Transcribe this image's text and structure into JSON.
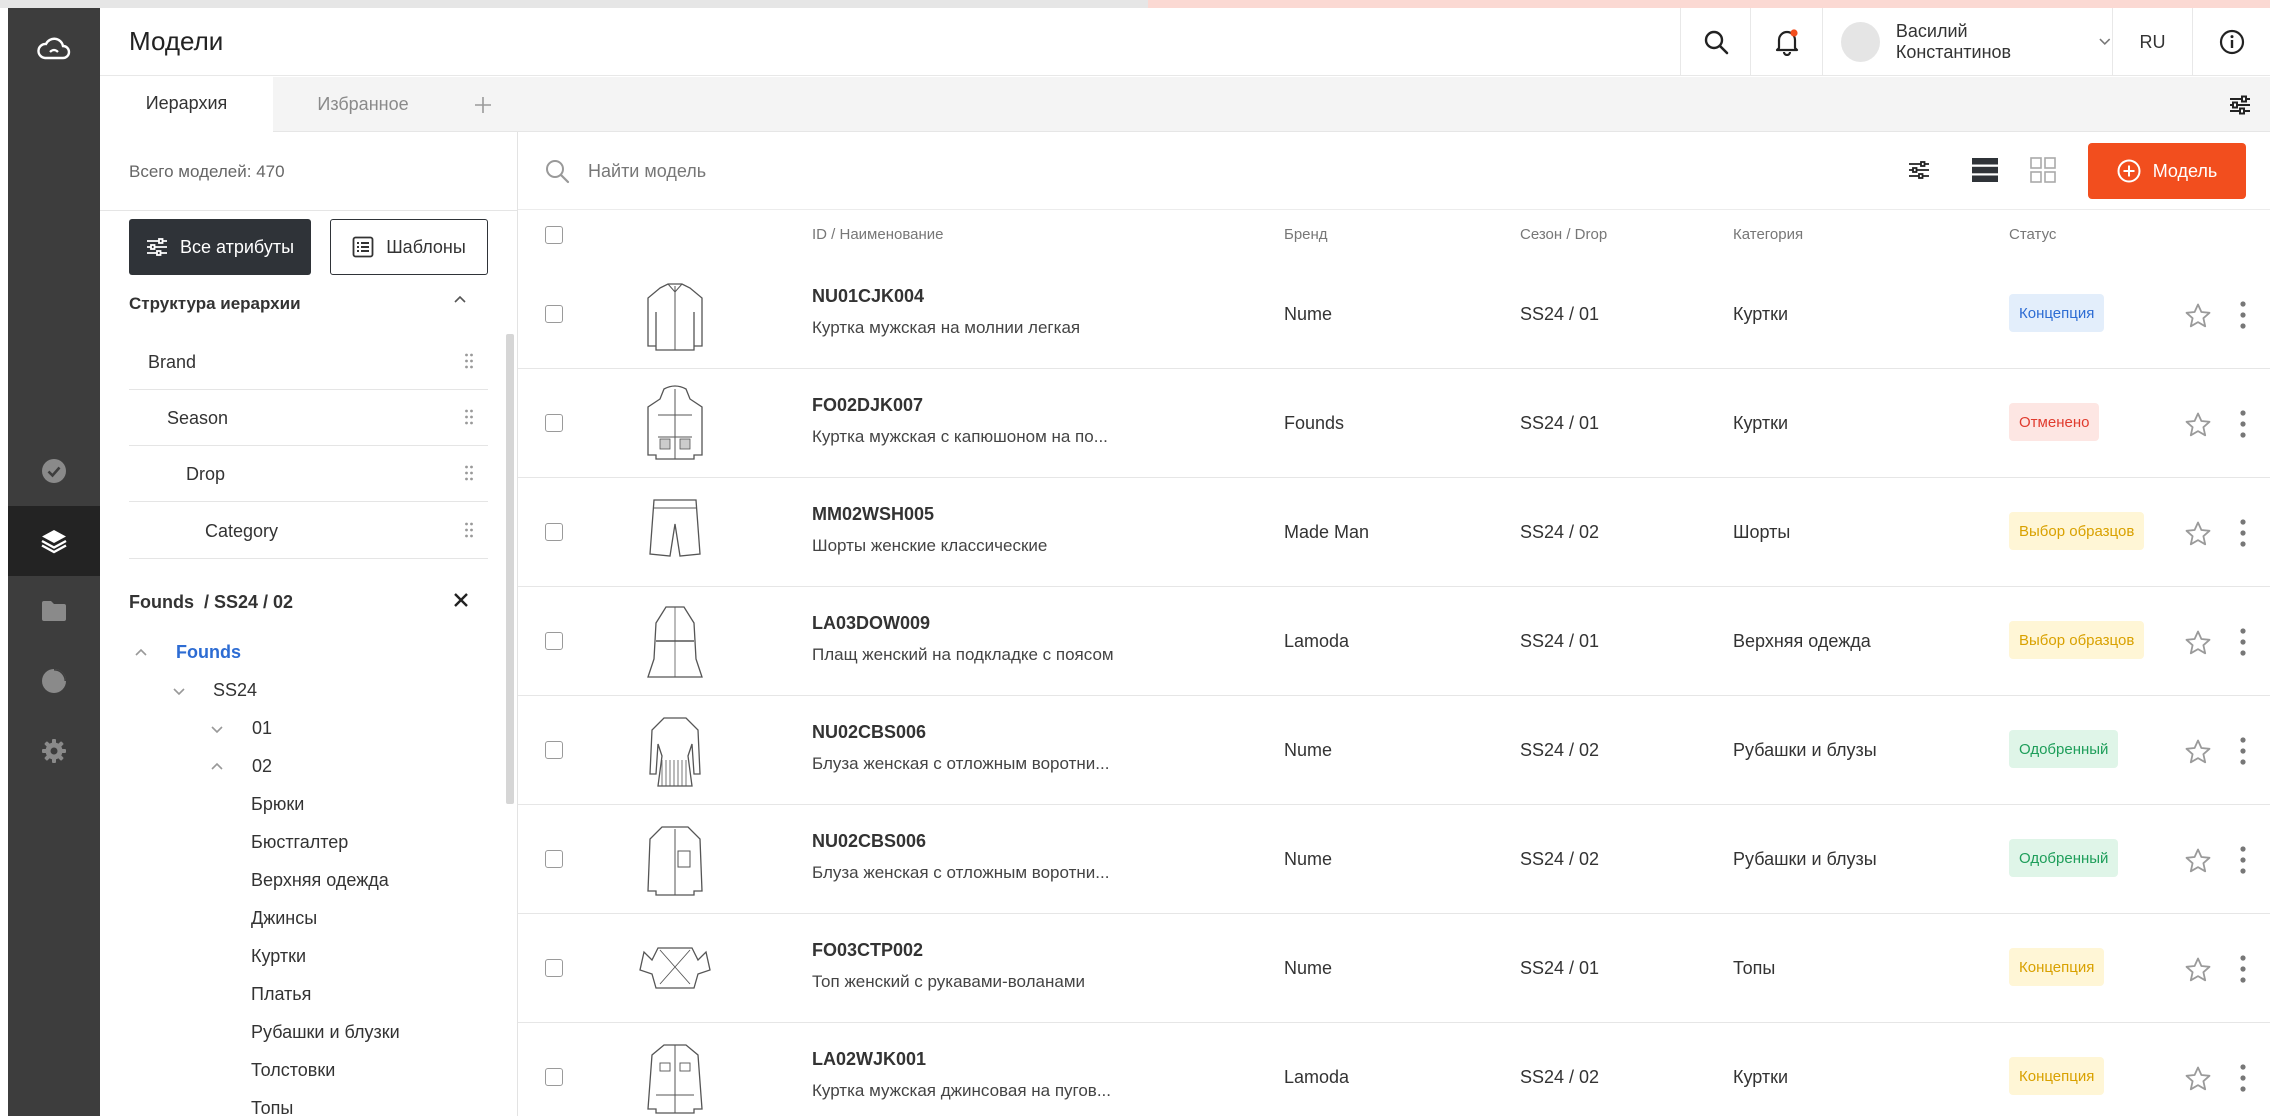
{
  "header": {
    "title": "Модели",
    "user_name": "Василий Константинов",
    "lang": "RU"
  },
  "tabs": [
    {
      "label": "Иерархия"
    },
    {
      "label": "Избранное"
    }
  ],
  "left_panel": {
    "count_label": "Всего моделей: 470",
    "all_attrs_label": "Все атрибуты",
    "templates_label": "Шаблоны",
    "structure_title": "Структура иерархии",
    "levels": [
      "Brand",
      "Season",
      "Drop",
      "Category"
    ],
    "path": "Founds  / SS24 / 02",
    "tree": {
      "brand": "Founds",
      "season": "SS24",
      "drops": [
        "01",
        "02"
      ],
      "categories": [
        "Брюки",
        "Бюстгалтер",
        "Верхняя одежда",
        "Джинсы",
        "Куртки",
        "Платья",
        "Рубашки и блузки",
        "Толстовки",
        "Топы"
      ]
    }
  },
  "search": {
    "placeholder": "Найти модель"
  },
  "add_model_label": "Модель",
  "table": {
    "columns": [
      "ID / Наименование",
      "Бренд",
      "Сезон / Drop",
      "Категория",
      "Статус"
    ],
    "rows": [
      {
        "id": "NU01CJK004",
        "name": "Куртка мужская на молнии легкая",
        "brand": "Nume",
        "season": "SS24 / 01",
        "category": "Куртки",
        "status": "Концепция",
        "status_color": "#2d6cd3",
        "status_bg": "#e3eefb"
      },
      {
        "id": "FO02DJK007",
        "name": "Куртка мужская с капюшоном на по...",
        "brand": "Founds",
        "season": "SS24 / 01",
        "category": "Куртки",
        "status": "Отменено",
        "status_color": "#e03b2e",
        "status_bg": "#fde6e3"
      },
      {
        "id": "MM02WSH005",
        "name": "Шорты женские классические",
        "brand": "Made Man",
        "season": "SS24 / 02",
        "category": "Шорты",
        "status": "Выбор образцов",
        "status_color": "#d9a100",
        "status_bg": "#fff6d6"
      },
      {
        "id": "LA03DOW009",
        "name": "Плащ женский на подкладке с поясом",
        "brand": "Lamoda",
        "season": "SS24 / 01",
        "category": "Верхняя одежда",
        "status": "Выбор образцов",
        "status_color": "#d9a100",
        "status_bg": "#fff6d6"
      },
      {
        "id": "NU02CBS006",
        "name": "Блуза женская с отложным воротни...",
        "brand": "Nume",
        "season": "SS24 / 02",
        "category": "Рубашки и блузы",
        "status": "Одобренный",
        "status_color": "#1e9e5a",
        "status_bg": "#dff5e8"
      },
      {
        "id": "NU02CBS006",
        "name": "Блуза женская с отложным воротни...",
        "brand": "Nume",
        "season": "SS24 / 02",
        "category": "Рубашки и блузы",
        "status": "Одобренный",
        "status_color": "#1e9e5a",
        "status_bg": "#dff5e8"
      },
      {
        "id": "FO03CTP002",
        "name": "Топ женский с рукавами-воланами",
        "brand": "Nume",
        "season": "SS24 / 01",
        "category": "Топы",
        "status": "Концепция",
        "status_color": "#d9a100",
        "status_bg": "#fff6d6"
      },
      {
        "id": "LA02WJK001",
        "name": "Куртка мужская джинсовая на пугов...",
        "brand": "Lamoda",
        "season": "SS24 / 02",
        "category": "Куртки",
        "status": "Концепция",
        "status_color": "#d9a100",
        "status_bg": "#fff6d6"
      }
    ]
  },
  "colors": {
    "rail": "#3d3d3d",
    "accent": "#f24e1e",
    "dark_button": "#2f3338",
    "tree_link": "#2d6cd3"
  }
}
